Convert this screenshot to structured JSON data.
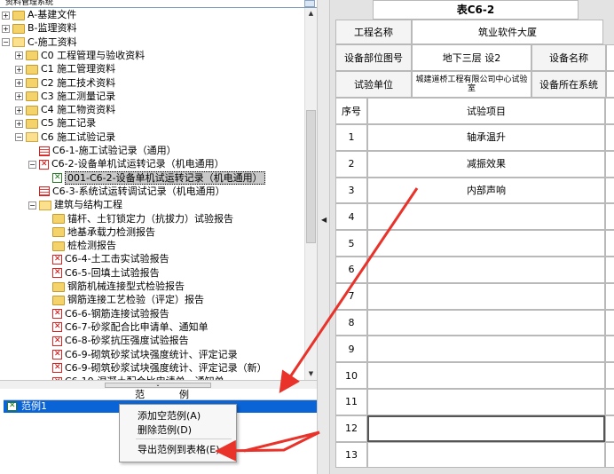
{
  "left": {
    "combo_text": "资料管理系统",
    "tree": [
      {
        "label": "A-基建文件",
        "icon": "folder-icon",
        "ctl": "+"
      },
      {
        "label": "B-监理资料",
        "icon": "folder-icon",
        "ctl": "+"
      },
      {
        "label": "C-施工资料",
        "icon": "folder-open-icon",
        "ctl": "-"
      },
      {
        "label": "C0 工程管理与验收资料",
        "icon": "folder-icon",
        "ctl": "+"
      },
      {
        "label": "C1 施工管理资料",
        "icon": "folder-icon",
        "ctl": "+"
      },
      {
        "label": "C2 施工技术资料",
        "icon": "folder-icon",
        "ctl": "+"
      },
      {
        "label": "C3 施工测量记录",
        "icon": "folder-icon",
        "ctl": "+"
      },
      {
        "label": "C4 施工物资资料",
        "icon": "folder-icon",
        "ctl": "+"
      },
      {
        "label": "C5 施工记录",
        "icon": "folder-icon",
        "ctl": "+"
      },
      {
        "label": "C6 施工试验记录",
        "icon": "folder-open-icon",
        "ctl": "-"
      },
      {
        "label": "C6-1-施工试验记录（通用）",
        "icon": "table-doc-icon",
        "ctl": ""
      },
      {
        "label": "C6-2-设备单机试运转记录（机电通用）",
        "icon": "red-doc-icon",
        "ctl": "-"
      },
      {
        "label": "001-C6-2-设备单机试运转记录（机电通用）",
        "icon": "green-doc-icon",
        "ctl": ""
      },
      {
        "label": "C6-3-系统试运转调试记录（机电通用）",
        "icon": "table-doc-icon",
        "ctl": ""
      },
      {
        "label": "建筑与结构工程",
        "icon": "folder-open-icon",
        "ctl": "-"
      },
      {
        "label": "锚杆、土钉锁定力（抗拔力）试验报告",
        "icon": "folder-icon",
        "ctl": ""
      },
      {
        "label": "地基承载力检测报告",
        "icon": "folder-icon",
        "ctl": ""
      },
      {
        "label": "桩检测报告",
        "icon": "folder-icon",
        "ctl": ""
      },
      {
        "label": "C6-4-土工击实试验报告",
        "icon": "red-doc-icon",
        "ctl": ""
      },
      {
        "label": "C6-5-回填土试验报告",
        "icon": "red-doc-icon",
        "ctl": ""
      },
      {
        "label": "钢筋机械连接型式检验报告",
        "icon": "folder-icon",
        "ctl": ""
      },
      {
        "label": "钢筋连接工艺检验（评定）报告",
        "icon": "folder-icon",
        "ctl": ""
      },
      {
        "label": "C6-6-钢筋连接试验报告",
        "icon": "red-doc-icon",
        "ctl": ""
      },
      {
        "label": "C6-7-砂浆配合比申请单、通知单",
        "icon": "red-doc-icon",
        "ctl": ""
      },
      {
        "label": "C6-8-砂浆抗压强度试验报告",
        "icon": "red-doc-icon",
        "ctl": ""
      },
      {
        "label": "C6-9-砌筑砂浆试块强度统计、评定记录",
        "icon": "red-doc-icon",
        "ctl": ""
      },
      {
        "label": "C6-9-砌筑砂浆试块强度统计、评定记录（新）",
        "icon": "red-doc-icon",
        "ctl": ""
      },
      {
        "label": "C6-10-混凝土配合比申请单、通知单",
        "icon": "red-doc-icon",
        "ctl": ""
      }
    ],
    "examples_header": {
      "col1": "范",
      "col2": "例"
    },
    "example_item": "范例1",
    "context_menu": {
      "add": "添加空范例(A)",
      "delete": "删除范例(D)",
      "export": "导出范例到表格(E)"
    }
  },
  "form": {
    "title": "表C6-2",
    "project_name_label": "工程名称",
    "project_name_value": "筑业软件大厦",
    "location_label": "设备部位图号",
    "location_value": "地下三层 设2",
    "device_name_label": "设备名称",
    "test_unit_label": "试验单位",
    "test_unit_value": "城建道桥工程有限公司中心试验室",
    "system_label": "设备所在系统",
    "seq_label": "序号",
    "item_label": "试验项目",
    "rows": [
      {
        "no": "1",
        "item": "轴承温升"
      },
      {
        "no": "2",
        "item": "减振效果"
      },
      {
        "no": "3",
        "item": "内部声响"
      },
      {
        "no": "4",
        "item": ""
      },
      {
        "no": "5",
        "item": ""
      },
      {
        "no": "6",
        "item": ""
      },
      {
        "no": "7",
        "item": ""
      },
      {
        "no": "8",
        "item": ""
      },
      {
        "no": "9",
        "item": ""
      },
      {
        "no": "10",
        "item": ""
      },
      {
        "no": "11",
        "item": ""
      },
      {
        "no": "12",
        "item": ""
      },
      {
        "no": "13",
        "item": ""
      }
    ]
  },
  "colors": {
    "selection": "#0a64d6",
    "arrow": "#e8322a",
    "tree_selected": "#c8c8c8"
  }
}
